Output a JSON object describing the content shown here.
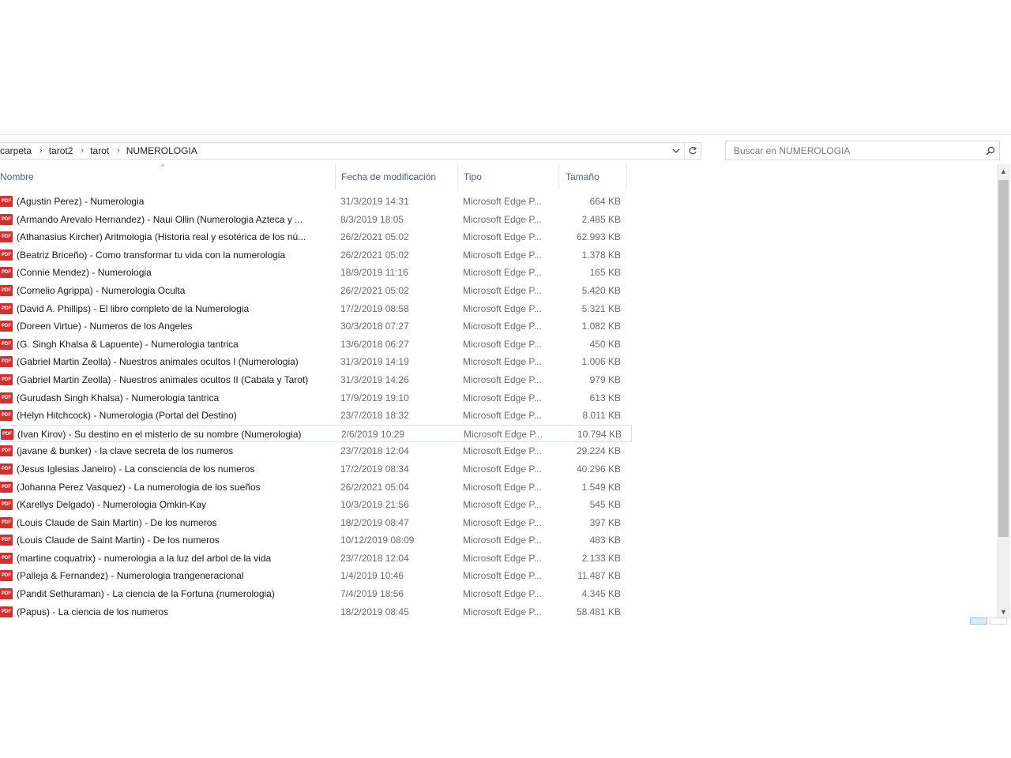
{
  "breadcrumb": [
    "carpeta",
    "tarot2",
    "tarot",
    "NUMEROLOGIA"
  ],
  "search": {
    "placeholder": "Buscar en NUMEROLOGIA",
    "value": ""
  },
  "columns": {
    "name": "Nombre",
    "date": "Fecha de modificación",
    "type": "Tipo",
    "size": "Tamaño"
  },
  "file_icon": "pdf-file-icon",
  "icon_text": "PDF",
  "colors": {
    "pdf_icon": "#d32f2f",
    "selection_border": "#cfe3f7",
    "header_text": "#4d6082"
  },
  "files": [
    {
      "name": "(Agustin Perez) - Numerologia",
      "date": "31/3/2019 14:31",
      "type": "Microsoft Edge P...",
      "size": "664 KB"
    },
    {
      "name": "(Armando Arevalo Hernandez) - Naui Ollin (Numerologia Azteca y ...",
      "date": "8/3/2019 18:05",
      "type": "Microsoft Edge P...",
      "size": "2.485 KB"
    },
    {
      "name": "(Athanasius Kircher) Aritmologia (Historia real y esotérica de los nú...",
      "date": "26/2/2021 05:02",
      "type": "Microsoft Edge P...",
      "size": "62.993 KB"
    },
    {
      "name": "(Beatriz Briceño) - Como transformar tu vida con la numerologia",
      "date": "26/2/2021 05:02",
      "type": "Microsoft Edge P...",
      "size": "1.378 KB"
    },
    {
      "name": "(Connie Mendez) - Numerologia",
      "date": "18/9/2019 11:16",
      "type": "Microsoft Edge P...",
      "size": "165 KB"
    },
    {
      "name": "(Cornelio Agrippa) - Numerologia Oculta",
      "date": "26/2/2021 05:02",
      "type": "Microsoft Edge P...",
      "size": "5.420 KB"
    },
    {
      "name": "(David A. Phillips) - El libro completo de la Numerologia",
      "date": "17/2/2019 08:58",
      "type": "Microsoft Edge P...",
      "size": "5.321 KB"
    },
    {
      "name": "(Doreen Virtue) - Numeros de los Angeles",
      "date": "30/3/2018 07:27",
      "type": "Microsoft Edge P...",
      "size": "1.082 KB"
    },
    {
      "name": "(G. Singh Khalsa & Lapuente) - Numerologia tantrica",
      "date": "13/6/2018 06:27",
      "type": "Microsoft Edge P...",
      "size": "450 KB"
    },
    {
      "name": "(Gabriel Martin Zeolla) - Nuestros animales ocultos I (Numerologia)",
      "date": "31/3/2019 14:19",
      "type": "Microsoft Edge P...",
      "size": "1.006 KB"
    },
    {
      "name": "(Gabriel Martin Zeolla) - Nuestros animales ocultos II (Cabala y Tarot)",
      "date": "31/3/2019 14:26",
      "type": "Microsoft Edge P...",
      "size": "979 KB"
    },
    {
      "name": "(Gurudash Singh Khalsa) - Numerologia tantrica",
      "date": "17/9/2019 19:10",
      "type": "Microsoft Edge P...",
      "size": "613 KB"
    },
    {
      "name": "(Helyn Hitchcock) - Numerologia (Portal del Destino)",
      "date": "23/7/2018 18:32",
      "type": "Microsoft Edge P...",
      "size": "8.011 KB"
    },
    {
      "name": "(Ivan Kirov) - Su destino en el misterio de su nombre (Numerologia)",
      "date": "2/6/2019 10:29",
      "type": "Microsoft Edge P...",
      "size": "10.794 KB",
      "selected": true
    },
    {
      "name": "(javane & bunker) - la clave secreta de los numeros",
      "date": "23/7/2018 12:04",
      "type": "Microsoft Edge P...",
      "size": "29.224 KB"
    },
    {
      "name": "(Jesus Iglesias Janeiro) - La consciencia de los numeros",
      "date": "17/2/2019 08:34",
      "type": "Microsoft Edge P...",
      "size": "40.296 KB"
    },
    {
      "name": "(Johanna Perez Vasquez) - La numerologia de los sueños",
      "date": "26/2/2021 05:04",
      "type": "Microsoft Edge P...",
      "size": "1.549 KB"
    },
    {
      "name": "(Karellys Delgado) - Numerologia Omkin-Kay",
      "date": "10/3/2019 21:56",
      "type": "Microsoft Edge P...",
      "size": "545 KB"
    },
    {
      "name": "(Louis Claude de Sain Martin) - De los numeros",
      "date": "18/2/2019 08:47",
      "type": "Microsoft Edge P...",
      "size": "397 KB"
    },
    {
      "name": "(Louis Claude de Saint Martin) - De los numeros",
      "date": "10/12/2019 08:09",
      "type": "Microsoft Edge P...",
      "size": "483 KB"
    },
    {
      "name": "(martine coquatrix) - numerologia a la luz del arbol de la vida",
      "date": "23/7/2018 12:04",
      "type": "Microsoft Edge P...",
      "size": "2.133 KB"
    },
    {
      "name": "(Palleja & Fernandez) - Numerologia trangeneracional",
      "date": "1/4/2019 10:46",
      "type": "Microsoft Edge P...",
      "size": "11.487 KB"
    },
    {
      "name": "(Pandit Sethuraman) - La ciencia de la Fortuna (numerologia)",
      "date": "7/4/2019 18:56",
      "type": "Microsoft Edge P...",
      "size": "4.345 KB"
    },
    {
      "name": "(Papus) - La ciencia de los numeros",
      "date": "18/2/2019 08:45",
      "type": "Microsoft Edge P...",
      "size": "58.481 KB"
    }
  ]
}
